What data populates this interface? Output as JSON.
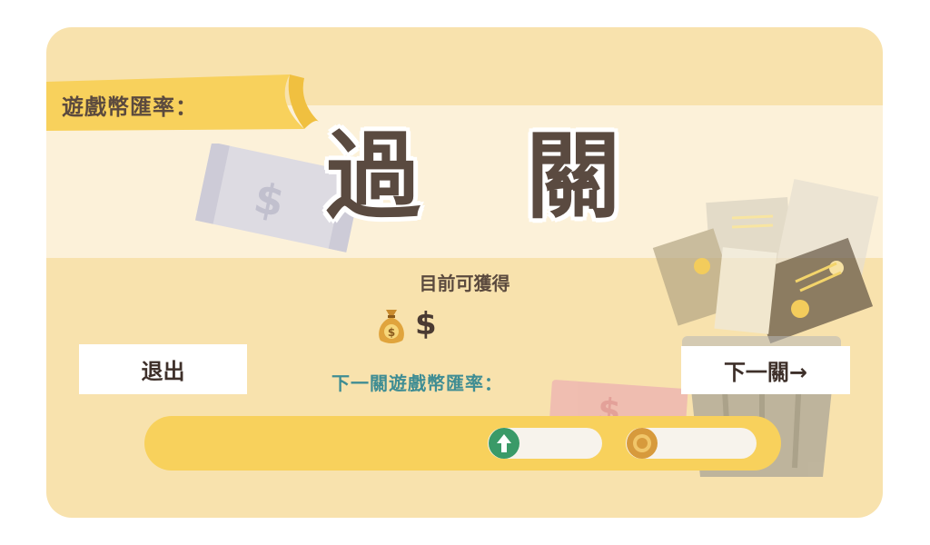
{
  "rate_label": "遊戲幣匯率：",
  "title": "過 關",
  "earn_label": "目前可獲得",
  "earn_currency": "$",
  "exit_button": "退出",
  "next_button": "下一關→",
  "next_rate_label": "下一關遊戲幣匯率：",
  "icons": {
    "bag": "money-bag-icon",
    "up": "up-arrow-icon",
    "coin": "coin-icon",
    "trash": "trash-can-decoration",
    "bill": "dollar-bill-decoration"
  },
  "colors": {
    "panel": "#f8e2ad",
    "band": "#fcf1d9",
    "ribbon": "#f8d15c",
    "bar": "#f8d15c",
    "title": "#5a4a40",
    "next_rate_label": "#3f8d93"
  }
}
